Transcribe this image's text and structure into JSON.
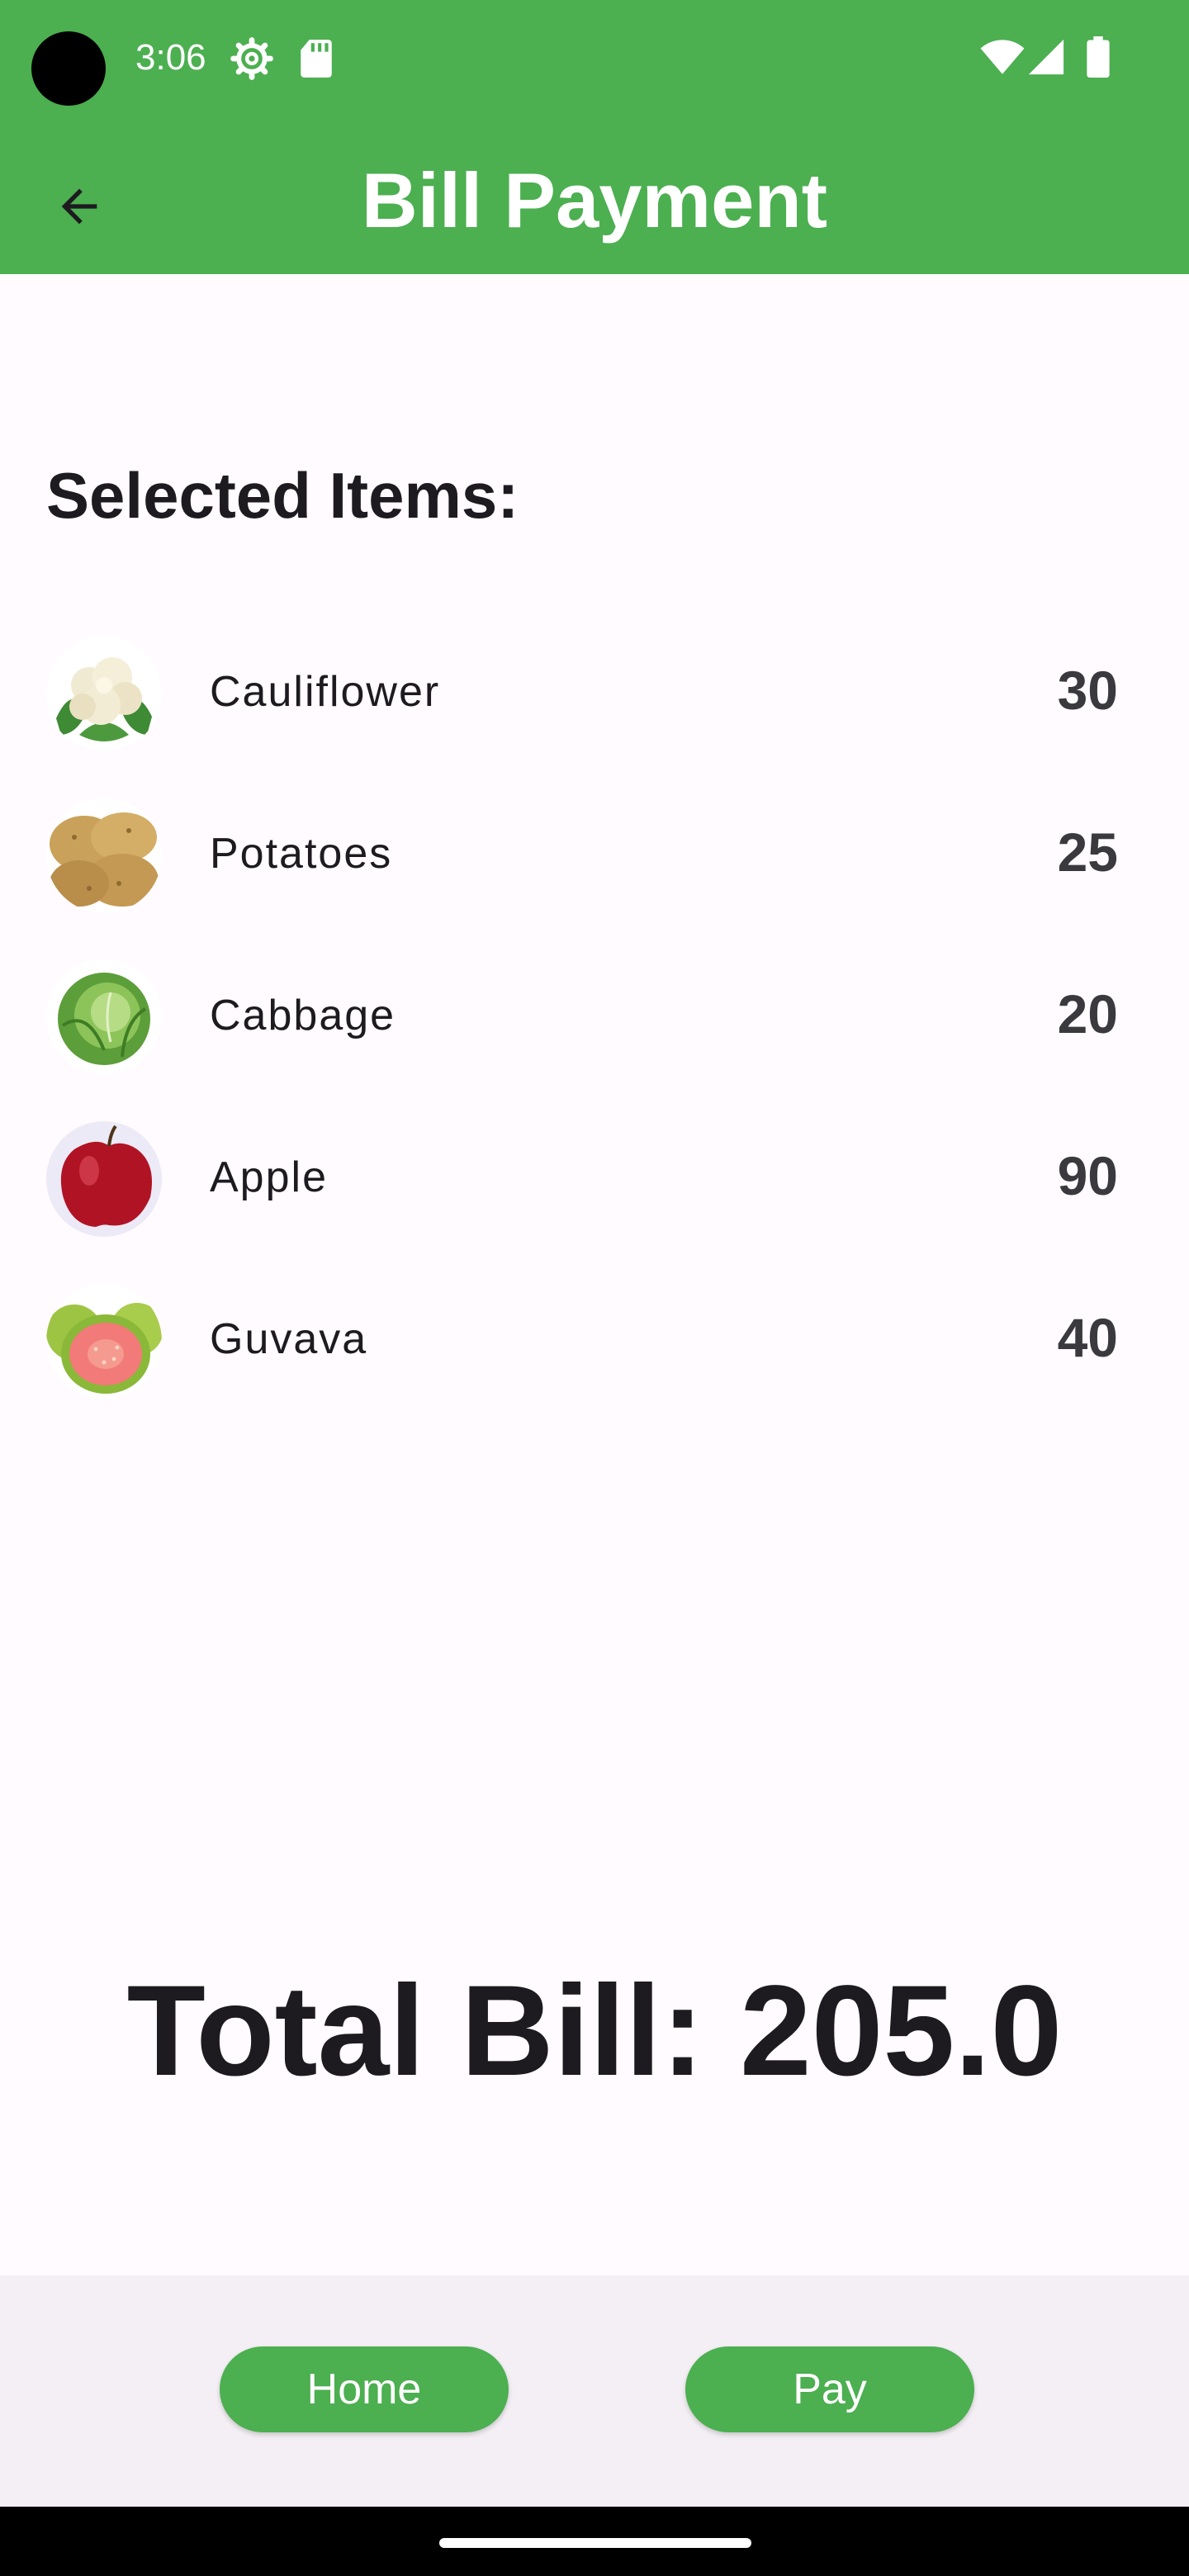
{
  "status_bar": {
    "time": "3:06",
    "icons": [
      "gear-icon",
      "sd-card-icon",
      "wifi-icon",
      "signal-icon",
      "battery-icon"
    ]
  },
  "app_bar": {
    "title": "Bill Payment",
    "back_icon": "arrow-back-icon",
    "color": "#4caf50"
  },
  "content": {
    "section_heading": "Selected Items:",
    "items": [
      {
        "name": "Cauliflower",
        "price": "30",
        "icon": "cauliflower-image"
      },
      {
        "name": "Potatoes",
        "price": "25",
        "icon": "potatoes-image"
      },
      {
        "name": "Cabbage",
        "price": "20",
        "icon": "cabbage-image"
      },
      {
        "name": "Apple",
        "price": "90",
        "icon": "apple-image"
      },
      {
        "name": "Guvava",
        "price": "40",
        "icon": "guava-image"
      }
    ],
    "total": "Total Bill: 205.0"
  },
  "bottom_bar": {
    "home_label": "Home",
    "pay_label": "Pay"
  },
  "colors": {
    "accent": "#4caf50",
    "background": "#fffbfe",
    "bottom_bar": "#f3eff4"
  }
}
